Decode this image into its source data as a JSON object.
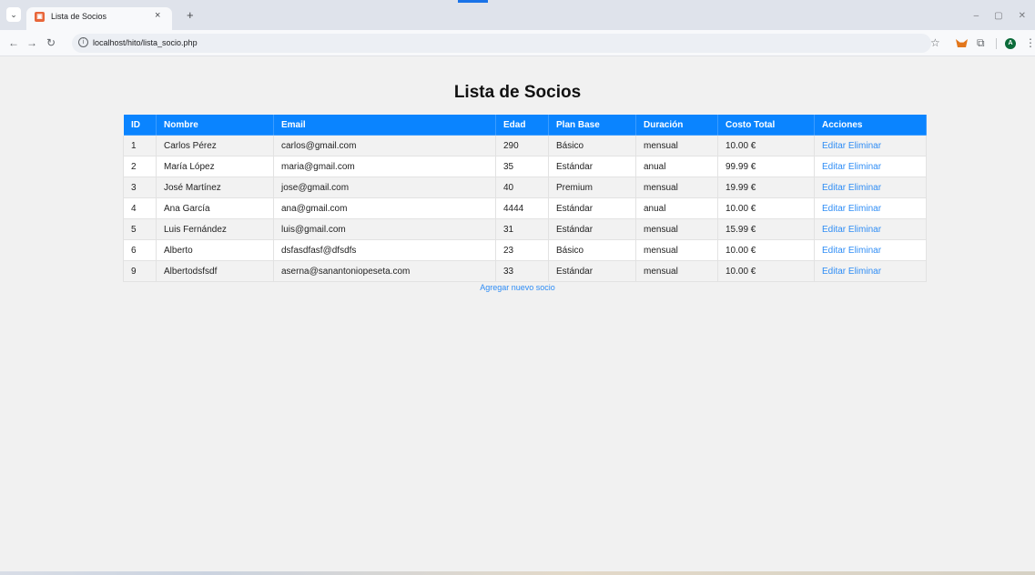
{
  "browser": {
    "tab_title": "Lista de Socios",
    "tab_close": "×",
    "new_tab": "+",
    "tab_menu": "⌄",
    "url": "localhost/hito/lista_socio.php",
    "avatar_letter": "A",
    "window_controls": [
      "–",
      "▢",
      "✕"
    ]
  },
  "page": {
    "title": "Lista de Socios",
    "add_link": "Agregar nuevo socio"
  },
  "table": {
    "headers": [
      "ID",
      "Nombre",
      "Email",
      "Edad",
      "Plan Base",
      "Duración",
      "Costo Total",
      "Acciones"
    ],
    "rows": [
      {
        "id": "1",
        "nombre": "Carlos Pérez",
        "email": "carlos@gmail.com",
        "edad": "290",
        "plan": "Básico",
        "duracion": "mensual",
        "costo": "10.00 €"
      },
      {
        "id": "2",
        "nombre": "María López",
        "email": "maria@gmail.com",
        "edad": "35",
        "plan": "Estándar",
        "duracion": "anual",
        "costo": "99.99 €"
      },
      {
        "id": "3",
        "nombre": "José Martínez",
        "email": "jose@gmail.com",
        "edad": "40",
        "plan": "Premium",
        "duracion": "mensual",
        "costo": "19.99 €"
      },
      {
        "id": "4",
        "nombre": "Ana García",
        "email": "ana@gmail.com",
        "edad": "4444",
        "plan": "Estándar",
        "duracion": "anual",
        "costo": "10.00 €"
      },
      {
        "id": "5",
        "nombre": "Luis Fernández",
        "email": "luis@gmail.com",
        "edad": "31",
        "plan": "Estándar",
        "duracion": "mensual",
        "costo": "15.99 €"
      },
      {
        "id": "6",
        "nombre": "Alberto",
        "email": "dsfasdfasf@dfsdfs",
        "edad": "23",
        "plan": "Básico",
        "duracion": "mensual",
        "costo": "10.00 €"
      },
      {
        "id": "9",
        "nombre": "Albertodsfsdf",
        "email": "aserna@sanantoniopeseta.com",
        "edad": "33",
        "plan": "Estándar",
        "duracion": "mensual",
        "costo": "10.00 €"
      }
    ],
    "actions": {
      "edit": "Editar",
      "delete": "Eliminar"
    }
  },
  "colors": {
    "header_bg": "#0a84ff",
    "link": "#2f8df5",
    "page_bg": "#f1f1f1"
  }
}
